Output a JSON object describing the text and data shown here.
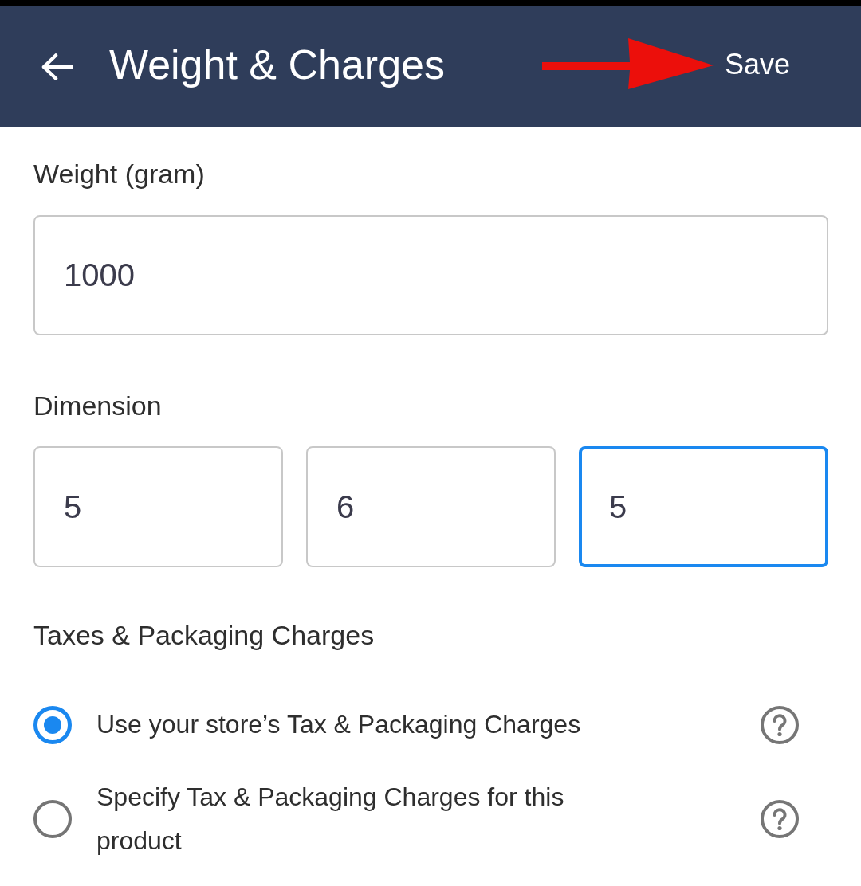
{
  "header": {
    "title": "Weight & Charges",
    "action": "Save"
  },
  "weight": {
    "label": "Weight (gram)",
    "value": "1000",
    "focused": false
  },
  "dimension": {
    "label": "Dimension",
    "fields": [
      {
        "value": "5",
        "focused": false
      },
      {
        "value": "6",
        "focused": false
      },
      {
        "value": "5",
        "focused": true
      }
    ]
  },
  "taxes": {
    "label": "Taxes & Packaging Charges",
    "options": [
      {
        "label": "Use your store’s Tax & Packaging Charges",
        "selected": true
      },
      {
        "label": "Specify Tax & Packaging Charges for this product",
        "selected": false
      }
    ]
  }
}
